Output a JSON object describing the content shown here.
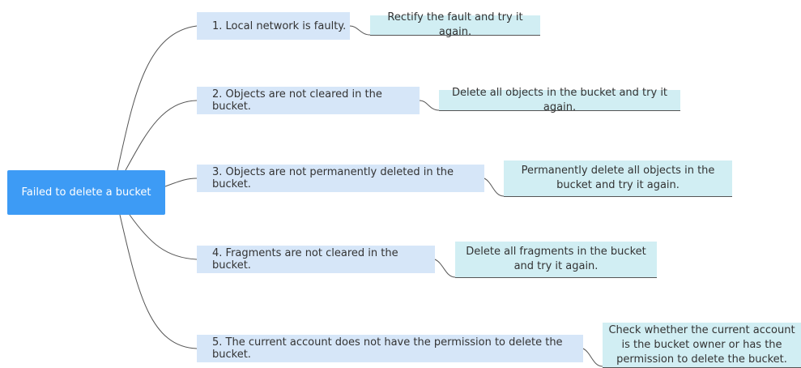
{
  "root": {
    "label": "Failed to delete a bucket"
  },
  "causes": [
    {
      "label": "1. Local network is faulty.",
      "solution": "Rectify the fault and try it again."
    },
    {
      "label": "2. Objects are not cleared in the bucket.",
      "solution": "Delete all objects in the bucket and try it again."
    },
    {
      "label": "3. Objects are not permanently deleted in the bucket.",
      "solution": "Permanently delete all objects in the bucket and try it again."
    },
    {
      "label": "4. Fragments are not cleared in the bucket.",
      "solution": "Delete all fragments in the bucket and try it again."
    },
    {
      "label": "5. The current account does not have the permission to delete the bucket.",
      "solution": "Check whether the current account is the bucket owner or has the permission to delete the bucket."
    }
  ],
  "colors": {
    "root": "#3d9bf5",
    "cause": "#d6e6f8",
    "solution": "#d1eef3",
    "connector": "#555555"
  }
}
